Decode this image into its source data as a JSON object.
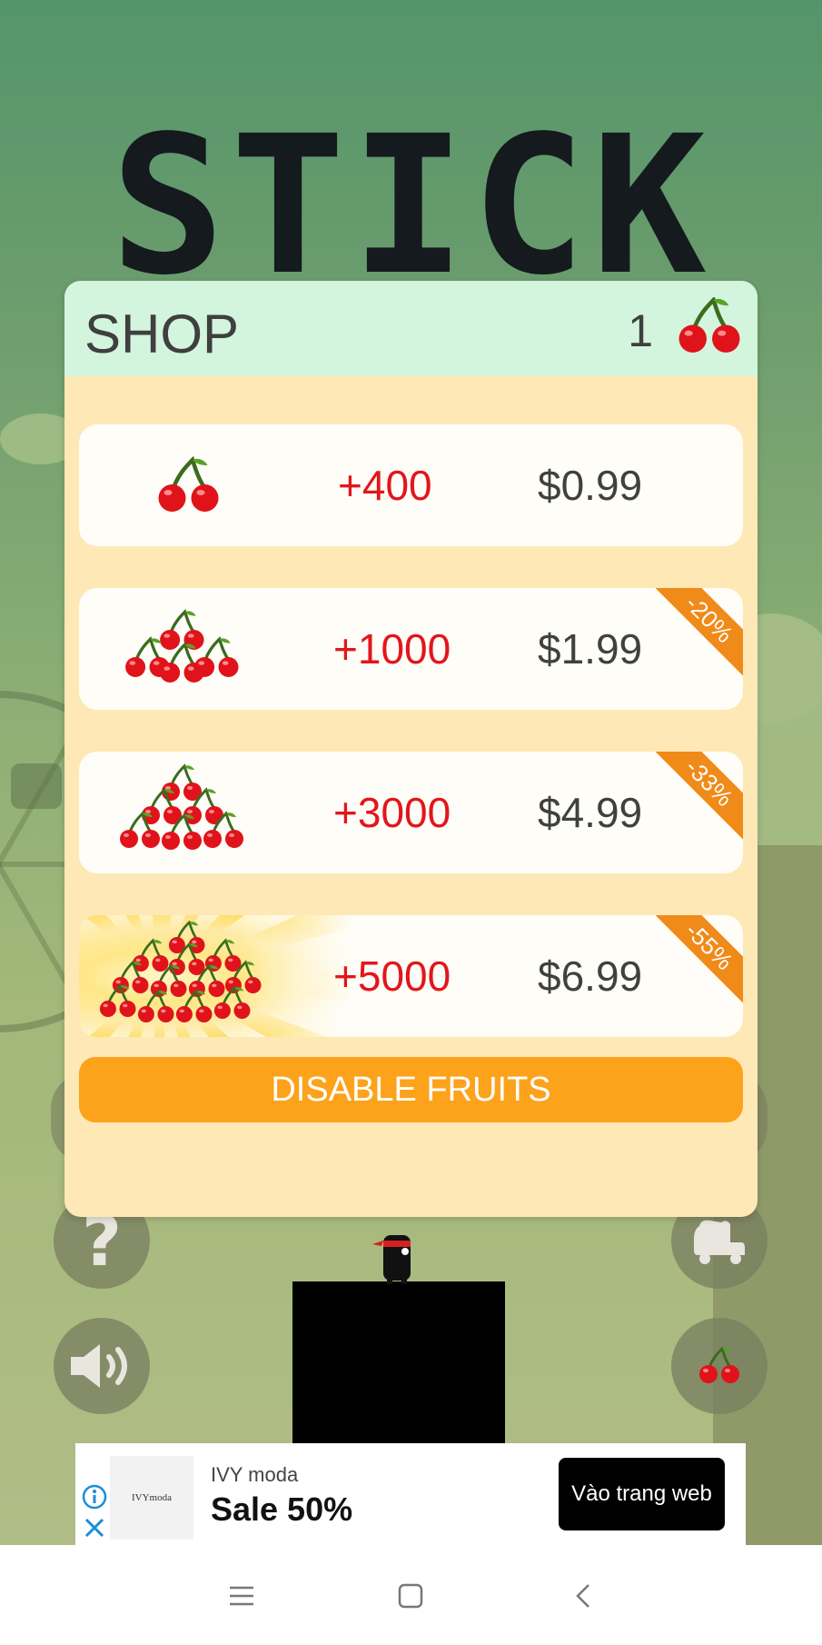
{
  "game": {
    "title": "STICK"
  },
  "shop": {
    "title": "SHOP",
    "fruit_count": "1",
    "items": [
      {
        "amount": "+400",
        "price": "$0.99",
        "discount": ""
      },
      {
        "amount": "+1000",
        "price": "$1.99",
        "discount": "-20%"
      },
      {
        "amount": "+3000",
        "price": "$4.99",
        "discount": "-33%"
      },
      {
        "amount": "+5000",
        "price": "$6.99",
        "discount": "-55%"
      }
    ],
    "disable_label": "DISABLE FRUITS"
  },
  "controls": {
    "help_glyph": "?",
    "icons": [
      "question-mark-icon",
      "speaker-icon",
      "vehicle-icon",
      "cherry-icon"
    ]
  },
  "ad": {
    "logo_text": "IVYmoda",
    "brand": "IVY moda",
    "headline": "Sale 50%",
    "cta": "Vào trang web"
  },
  "colors": {
    "accent_orange": "#fda21b",
    "price_red": "#e2161b",
    "panel_bg": "#fde8b6",
    "header_bg": "#d3f4dd"
  }
}
